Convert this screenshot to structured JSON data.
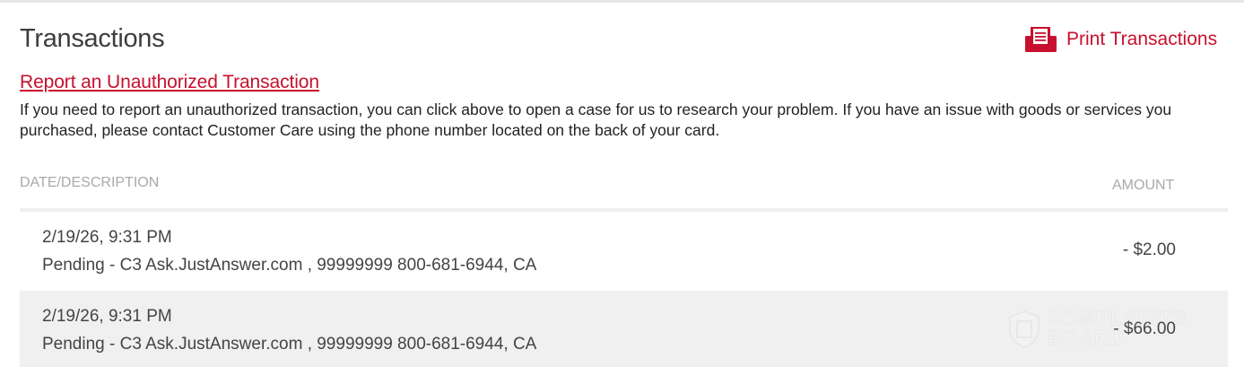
{
  "header": {
    "title": "Transactions",
    "print_label": "Print Transactions"
  },
  "report": {
    "link_label": "Report an Unauthorized Transaction",
    "info_text": "If you need to report an unauthorized transaction, you can click above to open a case for us to research your problem. If you have an issue with goods or services you purchased, please contact Customer Care using the phone number located on the back of your card."
  },
  "table": {
    "columns": {
      "date_description": "DATE/DESCRIPTION",
      "amount": "AMOUNT"
    },
    "rows": [
      {
        "date": "2/19/26, 9:31 PM",
        "description": "Pending - C3 Ask.JustAnswer.com , 99999999 800-681-6944, CA",
        "amount": "- $2.00"
      },
      {
        "date": "2/19/26, 9:31 PM",
        "description": "Pending - C3 Ask.JustAnswer.com , 99999999 800-681-6944, CA",
        "amount": "- $66.00"
      }
    ]
  },
  "watermark": {
    "line1": "COMPLAINTS",
    "line2": "BOARD"
  },
  "colors": {
    "accent": "#c8102e",
    "header_text": "#a9a9a9",
    "row_alt_bg": "#f0f0f0"
  },
  "icons": {
    "print": "printer-icon",
    "watermark": "shield-icon"
  }
}
